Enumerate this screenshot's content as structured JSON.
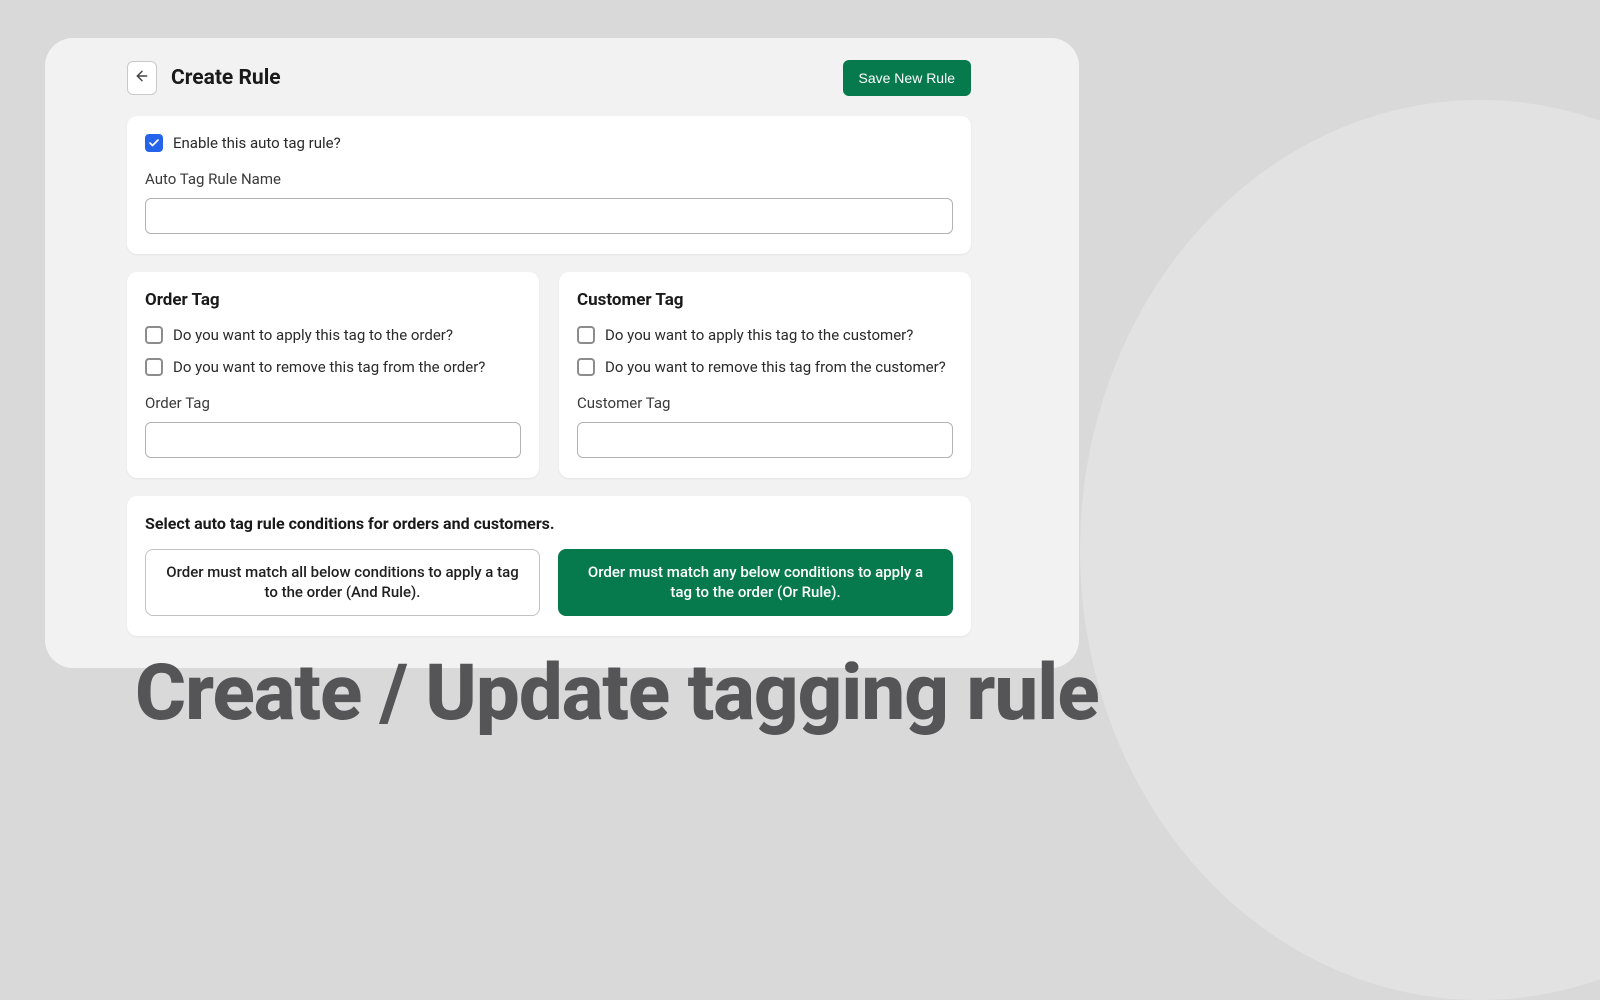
{
  "header": {
    "title": "Create Rule",
    "save_button": "Save New Rule"
  },
  "enable": {
    "checked": true,
    "label": "Enable this auto tag rule?"
  },
  "rule_name": {
    "label": "Auto Tag Rule Name",
    "value": ""
  },
  "order_tag": {
    "title": "Order Tag",
    "apply_label": "Do you want to apply this tag to the order?",
    "apply_checked": false,
    "remove_label": "Do you want to remove this tag from the order?",
    "remove_checked": false,
    "input_label": "Order Tag",
    "input_value": ""
  },
  "customer_tag": {
    "title": "Customer Tag",
    "apply_label": "Do you want to apply this tag to the customer?",
    "apply_checked": false,
    "remove_label": "Do you want to remove this tag from the customer?",
    "remove_checked": false,
    "input_label": "Customer Tag",
    "input_value": ""
  },
  "conditions": {
    "title": "Select auto tag rule conditions for orders and customers.",
    "and_rule": "Order must match all below conditions to apply a tag to the order (And Rule).",
    "or_rule": "Order must match any below conditions to apply a tag to the order (Or Rule).",
    "selected": "or"
  },
  "caption": "Create / Update tagging rule",
  "colors": {
    "primary": "#077a4d",
    "checkbox_checked": "#2563eb",
    "background": "#d9d9da"
  }
}
